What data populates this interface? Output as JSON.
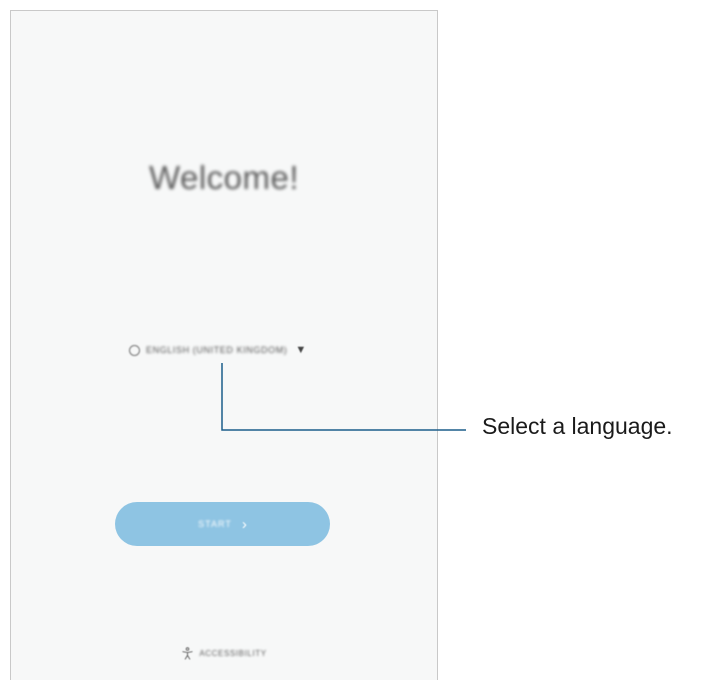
{
  "screen": {
    "title": "Welcome!",
    "language": {
      "label": "ENGLISH (UNITED KINGDOM)",
      "icon": "globe-icon",
      "caret": "▼"
    },
    "start_button": {
      "label": "START",
      "icon": "chevron-right-icon",
      "chevron": "›"
    },
    "accessibility": {
      "label": "ACCESSIBILITY",
      "icon": "accessibility-icon"
    }
  },
  "callout": {
    "text": "Select a language."
  },
  "colors": {
    "button": "#8ec4e3",
    "screen_bg": "#f7f8f8",
    "leader_line": "#1c5d8a"
  }
}
